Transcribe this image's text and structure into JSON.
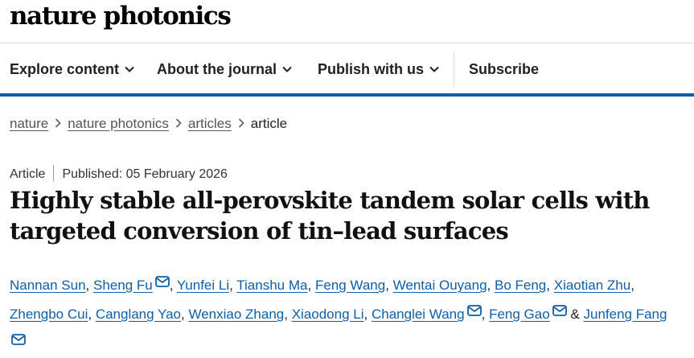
{
  "brand": {
    "name": "nature photonics"
  },
  "nav": {
    "items": [
      {
        "label": "Explore content",
        "has_dropdown": true
      },
      {
        "label": "About the journal",
        "has_dropdown": true
      },
      {
        "label": "Publish with us",
        "has_dropdown": true
      },
      {
        "label": "Subscribe",
        "has_dropdown": false
      }
    ]
  },
  "breadcrumb": {
    "items": [
      "nature",
      "nature photonics",
      "articles"
    ],
    "current": "article"
  },
  "article": {
    "type": "Article",
    "published": "Published: 05 February 2026",
    "title_line1": "Highly stable all-perovskite tandem solar cells with",
    "title_line2": "targeted conversion of tin–lead surfaces"
  },
  "authors": {
    "names": [
      "Nannan Sun",
      "Sheng Fu",
      "Yunfei Li",
      "Tianshu Ma",
      "Feng Wang",
      "Wentai Ouyang",
      "Bo Feng",
      "Xiaotian Zhu",
      "Zhengbo Cui",
      "Canglang Yao",
      "Wenxiao Zhang",
      "Xiaodong Li",
      "Changlei Wang",
      "Feng Gao",
      "Junfeng Fang"
    ],
    "separator": ",",
    "ampersand": "&"
  },
  "icons": {
    "dropdown": "chevron-down-icon",
    "crumb_separator": "chevron-right-icon",
    "contact": "mail-icon"
  },
  "colors": {
    "link": "#0f5ea8",
    "accent_bar": "#0f5ea8",
    "text": "#222222"
  }
}
